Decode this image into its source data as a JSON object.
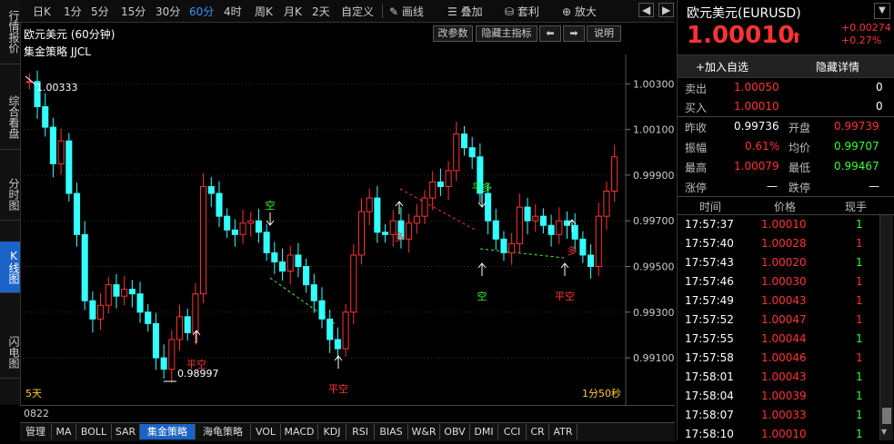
{
  "left_tabs": [
    "行情报价",
    "综合看盘",
    "分时图",
    "K线图",
    "闪电图"
  ],
  "left_tabs_active": 3,
  "toolbar": {
    "periods": [
      "日K",
      "1分",
      "5分",
      "15分",
      "30分",
      "60分",
      "4时",
      "周K",
      "月K",
      "2天",
      "自定义"
    ],
    "active_period": "60分",
    "tools": [
      "画线",
      "叠加",
      "套利",
      "放大"
    ],
    "nav": [
      "◀",
      "▶"
    ]
  },
  "chart": {
    "title": "欧元美元 (60分钟)",
    "strategy": "集金策略 JJCL",
    "buttons": [
      "改参数",
      "隐藏主指标",
      "⬅",
      "➡",
      "说明"
    ],
    "y_ticks": [
      "1.00300",
      "1.00100",
      "0.99900",
      "0.99700",
      "0.99500",
      "0.99300",
      "0.99100"
    ],
    "high_label": "1.00333",
    "low_label": "0.98997",
    "bottom_left": "5天",
    "bottom_right": "1分50秒",
    "signals": [
      "平空",
      "空",
      "平空",
      "多",
      "空",
      "平多",
      "平空",
      "多"
    ],
    "bottom_value": "0822"
  },
  "indicator_tabs": [
    "管理",
    "MA",
    "BOLL",
    "SAR",
    "集金策略",
    "海龟策略",
    "VOL",
    "MACD",
    "KDJ",
    "RSI",
    "BIAS",
    "W&R",
    "OBV",
    "DMI",
    "CCI",
    "CR",
    "ATR"
  ],
  "indicator_active": "集金策略",
  "quote": {
    "name": "欧元美元(EURUSD)",
    "price": "1.00010",
    "arrow": "⬆",
    "change": "+0.00274",
    "change_pct": "+0.27%",
    "add_watch": "+加入自选",
    "hide_detail": "隐藏详情",
    "sell_label": "卖出",
    "sell_price": "1.00050",
    "sell_vol": "0",
    "buy_label": "买入",
    "buy_price": "1.00010",
    "buy_vol": "0",
    "stats": [
      {
        "l1": "昨收",
        "v1": "0.99736",
        "l2": "开盘",
        "v2": "0.99739"
      },
      {
        "l1": "振幅",
        "v1": "0.61%",
        "l2": "均价",
        "v2": "0.99707"
      },
      {
        "l1": "最高",
        "v1": "1.00079",
        "l2": "最低",
        "v2": "0.99467"
      },
      {
        "l1": "涨停",
        "v1": "—",
        "l2": "跌停",
        "v2": "—"
      }
    ],
    "tick_headers": [
      "时间",
      "价格",
      "现手"
    ],
    "ticks": [
      {
        "time": "17:57:37",
        "price": "1.00010",
        "vol": "1",
        "vc": "green"
      },
      {
        "time": "17:57:40",
        "price": "1.00028",
        "vol": "1",
        "vc": "red"
      },
      {
        "time": "17:57:43",
        "price": "1.00020",
        "vol": "1",
        "vc": "green"
      },
      {
        "time": "17:57:46",
        "price": "1.00030",
        "vol": "1",
        "vc": "red"
      },
      {
        "time": "17:57:49",
        "price": "1.00043",
        "vol": "1",
        "vc": "red"
      },
      {
        "time": "17:57:52",
        "price": "1.00047",
        "vol": "1",
        "vc": "red"
      },
      {
        "time": "17:57:55",
        "price": "1.00044",
        "vol": "1",
        "vc": "green"
      },
      {
        "time": "17:57:58",
        "price": "1.00046",
        "vol": "1",
        "vc": "red"
      },
      {
        "time": "17:58:01",
        "price": "1.00043",
        "vol": "1",
        "vc": "green"
      },
      {
        "time": "17:58:04",
        "price": "1.00039",
        "vol": "1",
        "vc": "green"
      },
      {
        "time": "17:58:07",
        "price": "1.00033",
        "vol": "1",
        "vc": "green"
      },
      {
        "time": "17:58:10",
        "price": "1.00010",
        "vol": "1",
        "vc": "green"
      }
    ]
  }
}
